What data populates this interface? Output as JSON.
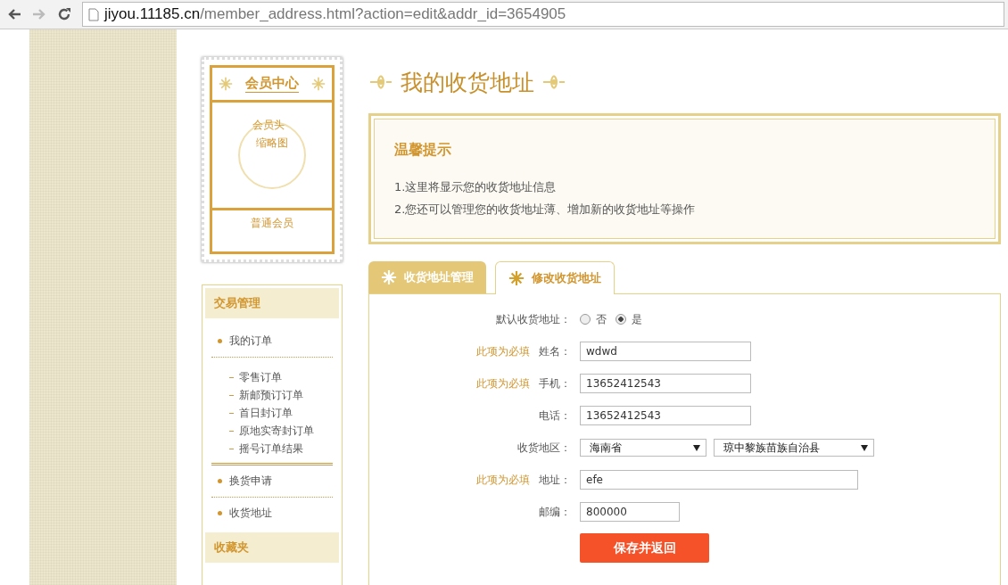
{
  "browser": {
    "url_host": "jiyou.11185.cn",
    "url_path": "/member_address.html?action=edit&addr_id=3654905"
  },
  "member_card": {
    "title": "会员中心",
    "avatar_alt_lines": [
      "会员头",
      "缩略图"
    ],
    "level": "普通会员"
  },
  "sidebar": [
    {
      "heading": "交易管理",
      "items": [
        {
          "kind": "bullet",
          "label": "我的订单"
        },
        {
          "kind": "sub",
          "label": "零售订单"
        },
        {
          "kind": "sub",
          "label": "新邮预订订单"
        },
        {
          "kind": "sub",
          "label": "首日封订单"
        },
        {
          "kind": "sub",
          "label": "原地实寄封订单"
        },
        {
          "kind": "sub",
          "label": "摇号订单结果"
        },
        {
          "kind": "bullet",
          "label": "换货申请"
        },
        {
          "kind": "bullet",
          "label": "收货地址"
        }
      ]
    },
    {
      "heading": "收藏夹"
    }
  ],
  "page_title": "我的收货地址",
  "tip": {
    "title": "温馨提示",
    "lines": [
      "1.这里将显示您的收货地址信息",
      "2.您还可以管理您的收货地址薄、增加新的收货地址等操作"
    ]
  },
  "tabs": [
    {
      "label": "收货地址管理",
      "selected": false
    },
    {
      "label": "修改收货地址",
      "selected": true
    }
  ],
  "form": [
    {
      "kind": "radio",
      "label": "默认收货地址：",
      "options": [
        {
          "label": "否",
          "selected": false
        },
        {
          "label": "是",
          "selected": true
        }
      ]
    },
    {
      "kind": "text",
      "required": "此项为必填",
      "label": "姓名：",
      "value": "wdwd"
    },
    {
      "kind": "text",
      "required": "此项为必填",
      "label": "手机：",
      "value": "13652412543"
    },
    {
      "kind": "text",
      "label": "电话：",
      "value": "13652412543"
    },
    {
      "kind": "select",
      "label": "收货地区：",
      "selects": [
        "海南省",
        "琼中黎族苗族自治县"
      ]
    },
    {
      "kind": "widetext",
      "required": "此项为必填",
      "label": "地址：",
      "value": "efe"
    },
    {
      "kind": "shorttext",
      "label": "邮编：",
      "value": "800000"
    }
  ],
  "submit": "保存并返回"
}
